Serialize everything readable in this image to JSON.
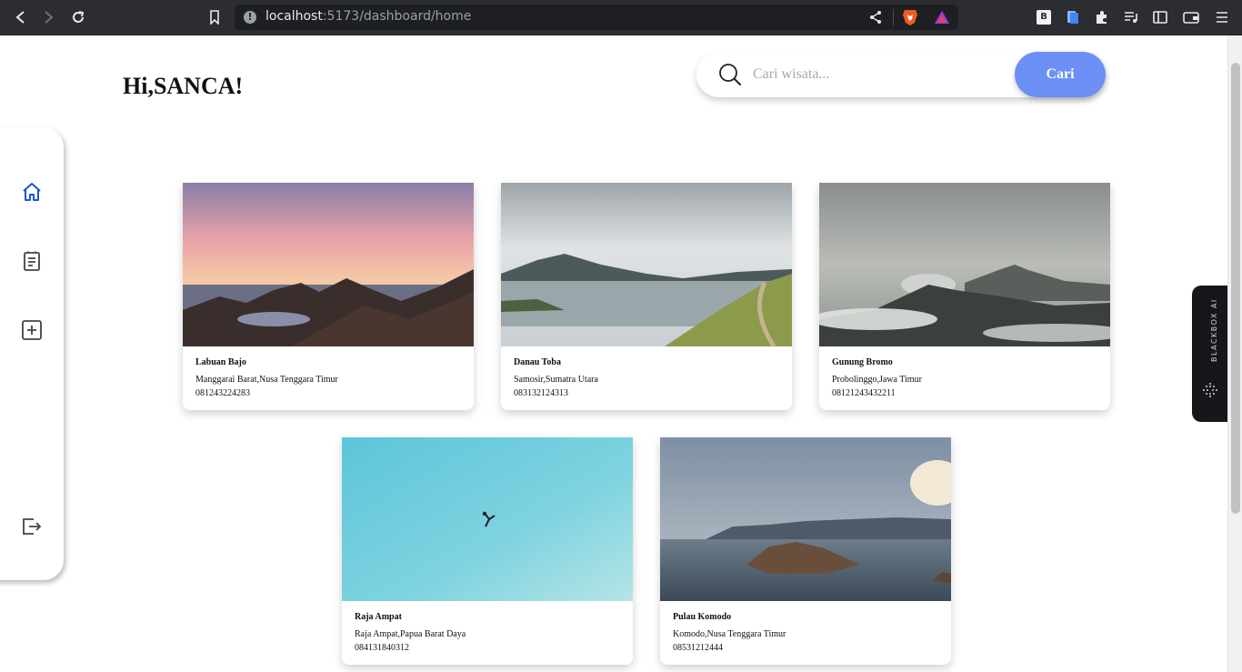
{
  "browser": {
    "url_host": "localhost",
    "url_path": ":5173/dashboard/home"
  },
  "page": {
    "greeting": "Hi,SANCA!",
    "search": {
      "placeholder": "Cari wisata...",
      "button_label": "Cari"
    },
    "sidebar": {
      "items": [
        {
          "icon": "home-icon",
          "active": true
        },
        {
          "icon": "clipboard-icon",
          "active": false
        },
        {
          "icon": "add-square-icon",
          "active": false
        },
        {
          "icon": "logout-icon",
          "active": false
        }
      ],
      "active_color": "#1a56db"
    },
    "destinations": [
      {
        "name": "Labuan Bajo",
        "location": "Manggarai Barat,Nusa Tenggara Timur",
        "phone": "081243224283"
      },
      {
        "name": "Danau Toba",
        "location": "Samosir,Sumatra Utara",
        "phone": "083132124313"
      },
      {
        "name": "Gunung Bromo",
        "location": "Probolinggo,Jawa Timur",
        "phone": "08121243432211"
      },
      {
        "name": "Raja Ampat",
        "location": "Raja Ampat,Papua Barat Daya",
        "phone": "084131840312"
      },
      {
        "name": "Pulau Komodo",
        "location": "Komodo,Nusa Tenggara Timur",
        "phone": "08531212444"
      }
    ]
  },
  "extension": {
    "label": "BLACKBOX AI"
  },
  "colors": {
    "accent": "#6b8ff5",
    "chrome": "#2b2d31",
    "urlbar": "#1d1f22"
  }
}
